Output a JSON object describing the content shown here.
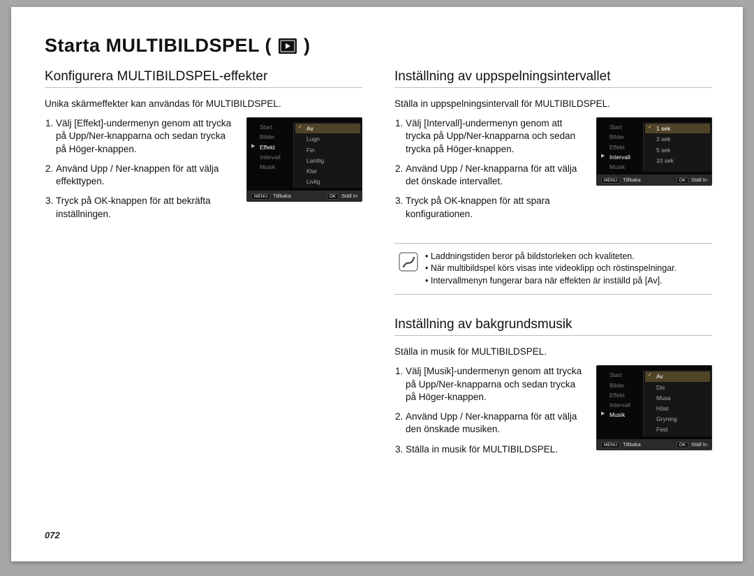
{
  "page_number": "072",
  "title_prefix": "Starta MULTIBILDSPEL ( ",
  "title_suffix": " )",
  "play_icon": "playback-icon",
  "left": {
    "heading": "Konfigurera MULTIBILDSPEL-effekter",
    "intro": "Unika skärmeffekter kan användas för MULTIBILDSPEL.",
    "steps": [
      "Välj [Effekt]-undermenyn genom att trycka på Upp/Ner-knapparna och sedan trycka på Höger-knappen.",
      "Använd Upp / Ner-knappen för att välja effekttypen.",
      "Tryck på OK-knappen för att bekräfta inställningen."
    ],
    "lcd": {
      "menu": [
        "Start",
        "Bilder",
        "Effekt",
        "Intervall",
        "Musik"
      ],
      "selected_index": 2,
      "options": [
        "Av",
        "Lugn",
        "Fin",
        "Lantlig",
        "Klar",
        "Livlig"
      ],
      "option_selected_index": 0,
      "bar_back_key": "MENU",
      "bar_back": "Tillbaka",
      "bar_set_key": "OK",
      "bar_set": "Ställ In"
    }
  },
  "right_top": {
    "heading": "Inställning av uppspelningsintervallet",
    "intro": "Ställa in uppspelningsintervall för MULTIBILDSPEL.",
    "steps": [
      "Välj [Intervall]-undermenyn genom att trycka på Upp/Ner-knapparna och sedan trycka på Höger-knappen.",
      "Använd Upp / Ner-knapparna för att välja det önskade intervallet.",
      "Tryck på OK-knappen för att spara konfigurationen."
    ],
    "lcd": {
      "menu": [
        "Start",
        "Bilder",
        "Effekt",
        "Intervall",
        "Musik"
      ],
      "selected_index": 3,
      "options": [
        "1 sek",
        "3 sek",
        "5 sek",
        "10 sek"
      ],
      "option_selected_index": 0,
      "bar_back_key": "MENU",
      "bar_back": "Tillbaka",
      "bar_set_key": "OK",
      "bar_set": "Ställ In"
    },
    "notes": [
      "Laddningstiden beror på bildstorleken och kvaliteten.",
      "När multibildspel körs visas inte videoklipp och röstinspelningar.",
      "Intervallmenyn fungerar bara när effekten är inställd på [Av]."
    ]
  },
  "right_bottom": {
    "heading": "Inställning av bakgrundsmusik",
    "intro": "Ställa in musik för MULTIBILDSPEL.",
    "steps": [
      "Välj [Musik]-undermenyn genom att trycka på Upp/Ner-knapparna och sedan trycka på Höger-knappen.",
      "Använd Upp / Ner-knapparna för att välja den önskade musiken.",
      "Ställa in musik för MULTIBILDSPEL."
    ],
    "lcd": {
      "menu": [
        "Start",
        "Bilder",
        "Effekt",
        "Intervall",
        "Musik"
      ],
      "selected_index": 4,
      "options": [
        "Av",
        "Dis",
        "Musa",
        "Höst",
        "Gryning",
        "Fest"
      ],
      "option_selected_index": 0,
      "bar_back_key": "MENU",
      "bar_back": "Tillbaka",
      "bar_set_key": "OK",
      "bar_set": "Ställ In"
    }
  }
}
